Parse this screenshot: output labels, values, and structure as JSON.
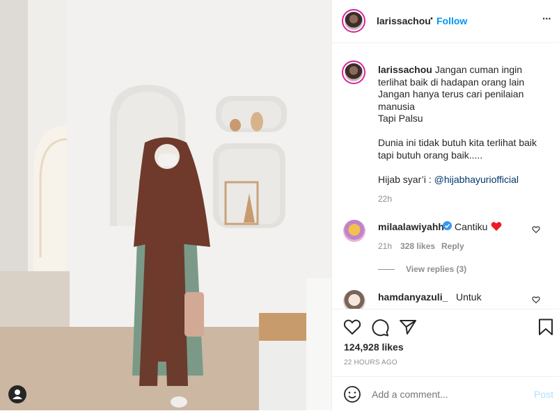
{
  "post": {
    "username": "larissachou",
    "follow_label": "Follow",
    "more_label": "•••",
    "separator": "•"
  },
  "caption": {
    "username": "larissachou",
    "line1": "Jangan cuman ingin terlihat baik di hadapan orang lain",
    "line2": "Jangan hanya terus cari penilaian manusia",
    "line3": "Tapi Palsu",
    "line4": "Dunia ini tidak butuh kita terlihat baik tapi butuh orang baik.....",
    "hijab_prefix": "Hijab syar’i : ",
    "hijab_link": "@hijabhayuriofficial",
    "time": "22h"
  },
  "comments": [
    {
      "username": "milaalawiyahh",
      "verified": true,
      "text": "Cantiku",
      "emoji": "heart",
      "time": "21h",
      "likes": "328 likes",
      "reply_label": "Reply",
      "view_replies": "View replies (3)"
    },
    {
      "username": "hamdanyazuli_",
      "text": "Untuk"
    }
  ],
  "stats": {
    "likes": "124,928 likes",
    "timestamp": "22 HOURS AGO"
  },
  "add_comment": {
    "placeholder": "Add a comment...",
    "post_label": "Post"
  },
  "colors": {
    "accent": "#0095f6",
    "heart": "#ed4956",
    "verified": "#3897f0",
    "muted": "#8e8e8e"
  }
}
